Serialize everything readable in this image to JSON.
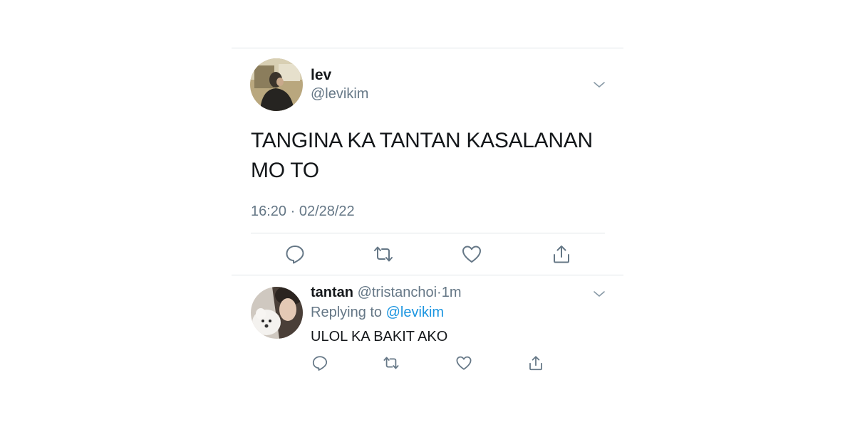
{
  "main_tweet": {
    "name": "lev",
    "handle": "@levikim",
    "text_line1": "TANGINA KA TANTAN KASALANAN",
    "text_line2": "MO TO",
    "timestamp": "16:20 · 02/28/22",
    "actions": [
      "reply-icon",
      "retweet-icon",
      "like-icon",
      "share-icon"
    ]
  },
  "reply_tweet": {
    "name": "tantan",
    "handle": "@tristanchoi",
    "separator": "·",
    "time": "1m",
    "replying_prefix": "Replying to ",
    "replying_to": "@levikim",
    "text": "ULOL KA BAKIT AKO",
    "actions": [
      "reply-icon",
      "retweet-icon",
      "like-icon",
      "share-icon"
    ]
  },
  "colors": {
    "text": "#14171a",
    "secondary": "#657786",
    "link": "#1b95e0",
    "divider": "#e1e5e8",
    "icon": "#657786"
  }
}
